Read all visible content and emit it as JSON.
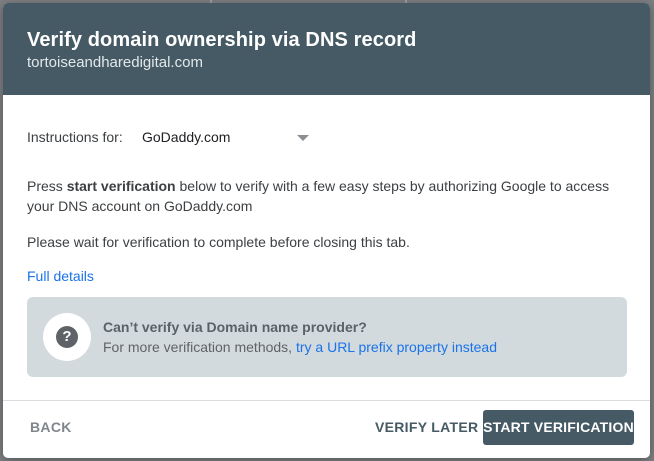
{
  "dialog": {
    "title": "Verify domain ownership via DNS record",
    "domain": "tortoiseandharedigital.com"
  },
  "instructions": {
    "label": "Instructions for:",
    "selected_provider": "GoDaddy.com"
  },
  "body": {
    "para1_prefix": "Press ",
    "para1_bold": "start verification",
    "para1_suffix": " below to verify with a few easy steps by authorizing Google to access your DNS account on GoDaddy.com",
    "para2": "Please wait for verification to complete before closing this tab.",
    "full_details_link": "Full details"
  },
  "info_box": {
    "icon": "help-icon",
    "icon_glyph": "?",
    "title": "Can’t verify via Domain name provider?",
    "text_prefix": "For more verification methods, ",
    "link_text": "try a URL prefix property instead"
  },
  "footer": {
    "back_label": "BACK",
    "verify_later_label": "VERIFY LATER",
    "start_verification_label": "START VERIFICATION"
  },
  "colors": {
    "header_bg": "#455a64",
    "info_box_bg": "#d2dadd",
    "link": "#1a73e8",
    "primary_button": "#455a64"
  }
}
